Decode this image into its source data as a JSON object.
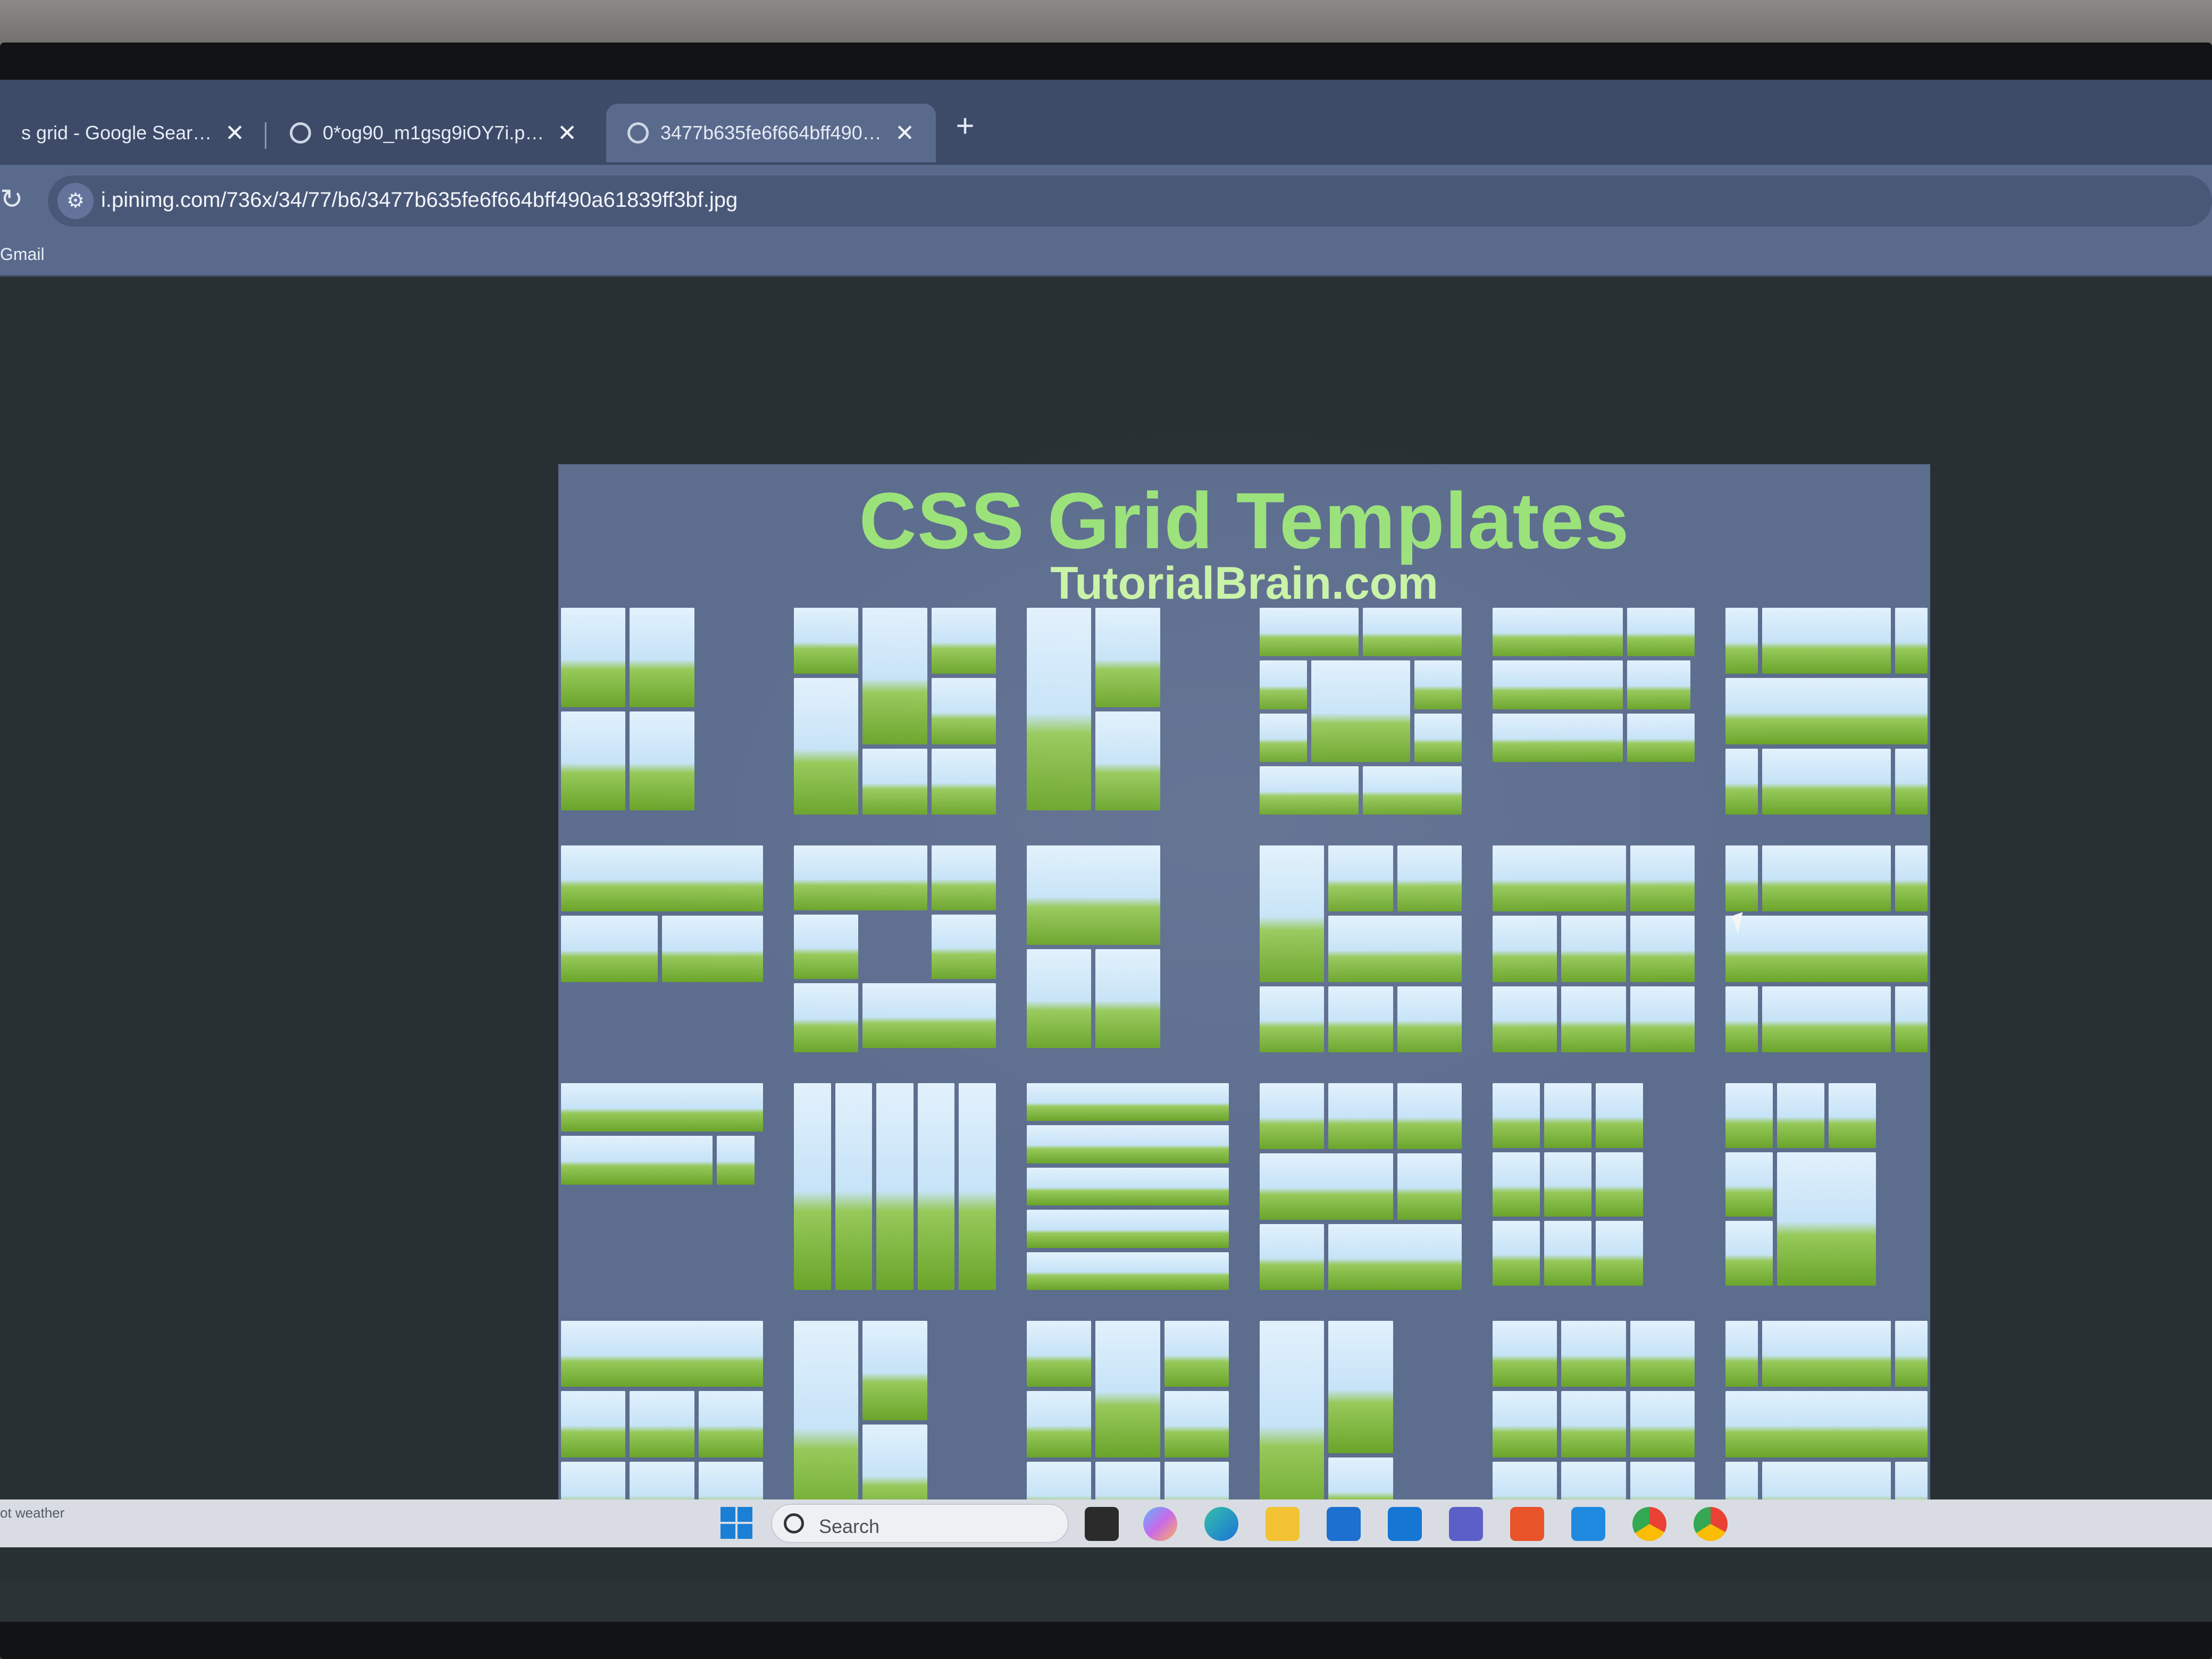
{
  "browser": {
    "tabs": [
      {
        "label": "s grid - Google Search",
        "active": false
      },
      {
        "label": "0*og90_m1gsg9iOY7i.png (180",
        "active": false
      },
      {
        "label": "3477b635fe6f664bff490a61839",
        "active": true
      }
    ],
    "close_glyph": "✕",
    "new_tab_glyph": "+",
    "reload_glyph": "↻",
    "site_info_glyph": "⚙",
    "url": "i.pinimg.com/736x/34/77/b6/3477b635fe6f664bff490a61839ff3bf.jpg",
    "bookmarks": [
      "Gmail"
    ]
  },
  "image": {
    "title": "CSS Grid Templates",
    "subtitle": "TutorialBrain.com"
  },
  "taskbar": {
    "weather_text": "ot weather",
    "search_placeholder": "Search",
    "pinned_icons": [
      "task-view-icon",
      "copilot-icon",
      "edge-icon",
      "file-explorer-icon",
      "store-icon",
      "outlook-icon",
      "teams-icon",
      "brave-icon",
      "vscode-icon",
      "chrome-icon",
      "chrome-profile-icon"
    ]
  },
  "colors": {
    "title": "#9be27a",
    "subtitle": "#c8f3a6",
    "poster_bg": "#5d6d8e",
    "browser_chrome": "#5a6a8c"
  }
}
